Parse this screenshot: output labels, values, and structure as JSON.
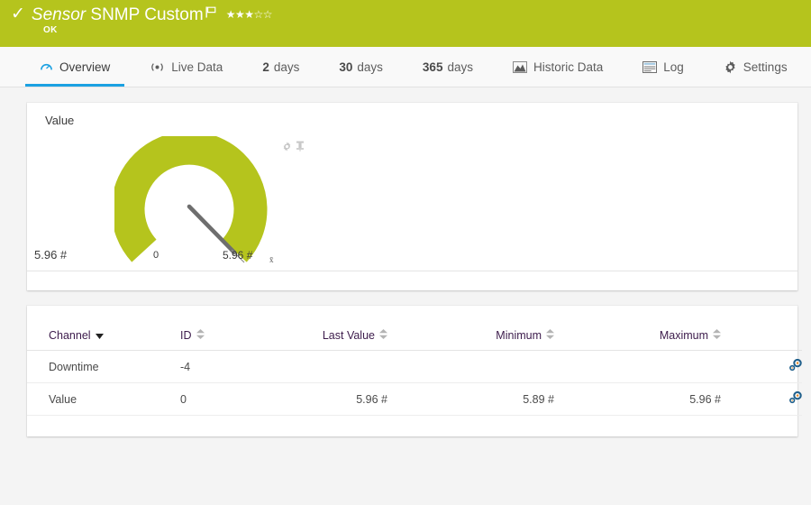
{
  "theme": {
    "status_color": "#b5c41d",
    "accent_blue": "#1ba1e2",
    "page_bg": "#f4f4f4",
    "header_text_color": "#3c1b4b",
    "needle_color": "#6e6e6e"
  },
  "header": {
    "check_icon": "check-icon",
    "kind_label": "Sensor",
    "name_label": "SNMP Custom",
    "flag_icon": "flag-icon",
    "stars_filled": 3,
    "stars_total": 5,
    "stars_text": "★★★☆☆",
    "status_label": "OK"
  },
  "tabs": [
    {
      "label": "Overview",
      "icon": "gauge-icon",
      "active": true,
      "num": ""
    },
    {
      "label": "Live Data",
      "icon": "live-signal-icon",
      "active": false,
      "num": ""
    },
    {
      "label": "days",
      "icon": "",
      "active": false,
      "num": "2"
    },
    {
      "label": "days",
      "icon": "",
      "active": false,
      "num": "30"
    },
    {
      "label": "days",
      "icon": "",
      "active": false,
      "num": "365"
    },
    {
      "label": "Historic Data",
      "icon": "area-chart-icon",
      "active": false,
      "num": ""
    },
    {
      "label": "Log",
      "icon": "log-list-icon",
      "active": false,
      "num": ""
    },
    {
      "label": "Settings",
      "icon": "gear-icon",
      "active": false,
      "num": ""
    }
  ],
  "gauge_card": {
    "title": "Value",
    "current_value": "5.96 #",
    "scale_min_label": "0",
    "scale_max_label": "5.96 #",
    "mean_marker_label": "x̄",
    "gear_icon": "gear-icon",
    "pin_icon": "pin-icon"
  },
  "chart_data": {
    "type": "gauge",
    "title": "Value",
    "unit": "#",
    "value": 5.96,
    "min": 0,
    "max": 5.96,
    "ymin_label": "0",
    "ymax_label": "5.96 #",
    "value_label": "5.96 #",
    "mean_marker": {
      "label": "x̄",
      "value": 5.96
    },
    "arc_color": "#b5c41d",
    "needle_color": "#6e6e6e",
    "fill_fraction": 1.0,
    "arc_start_deg": 225,
    "arc_sweep_deg": 270,
    "grid": false,
    "legend": "none"
  },
  "table": {
    "columns": [
      {
        "key": "channel",
        "label": "Channel",
        "sort": "desc-caret"
      },
      {
        "key": "id",
        "label": "ID",
        "sort": "updown"
      },
      {
        "key": "last",
        "label": "Last Value",
        "sort": "updown"
      },
      {
        "key": "min",
        "label": "Minimum",
        "sort": "updown"
      },
      {
        "key": "max",
        "label": "Maximum",
        "sort": "updown"
      },
      {
        "key": "actions",
        "label": "",
        "sort": ""
      }
    ],
    "rows": [
      {
        "channel": "Downtime",
        "id": "-4",
        "last": "",
        "min": "",
        "max": "",
        "action_icon": "gears-icon"
      },
      {
        "channel": "Value",
        "id": "0",
        "last": "5.96 #",
        "min": "5.89 #",
        "max": "5.96 #",
        "action_icon": "gears-icon"
      }
    ]
  }
}
